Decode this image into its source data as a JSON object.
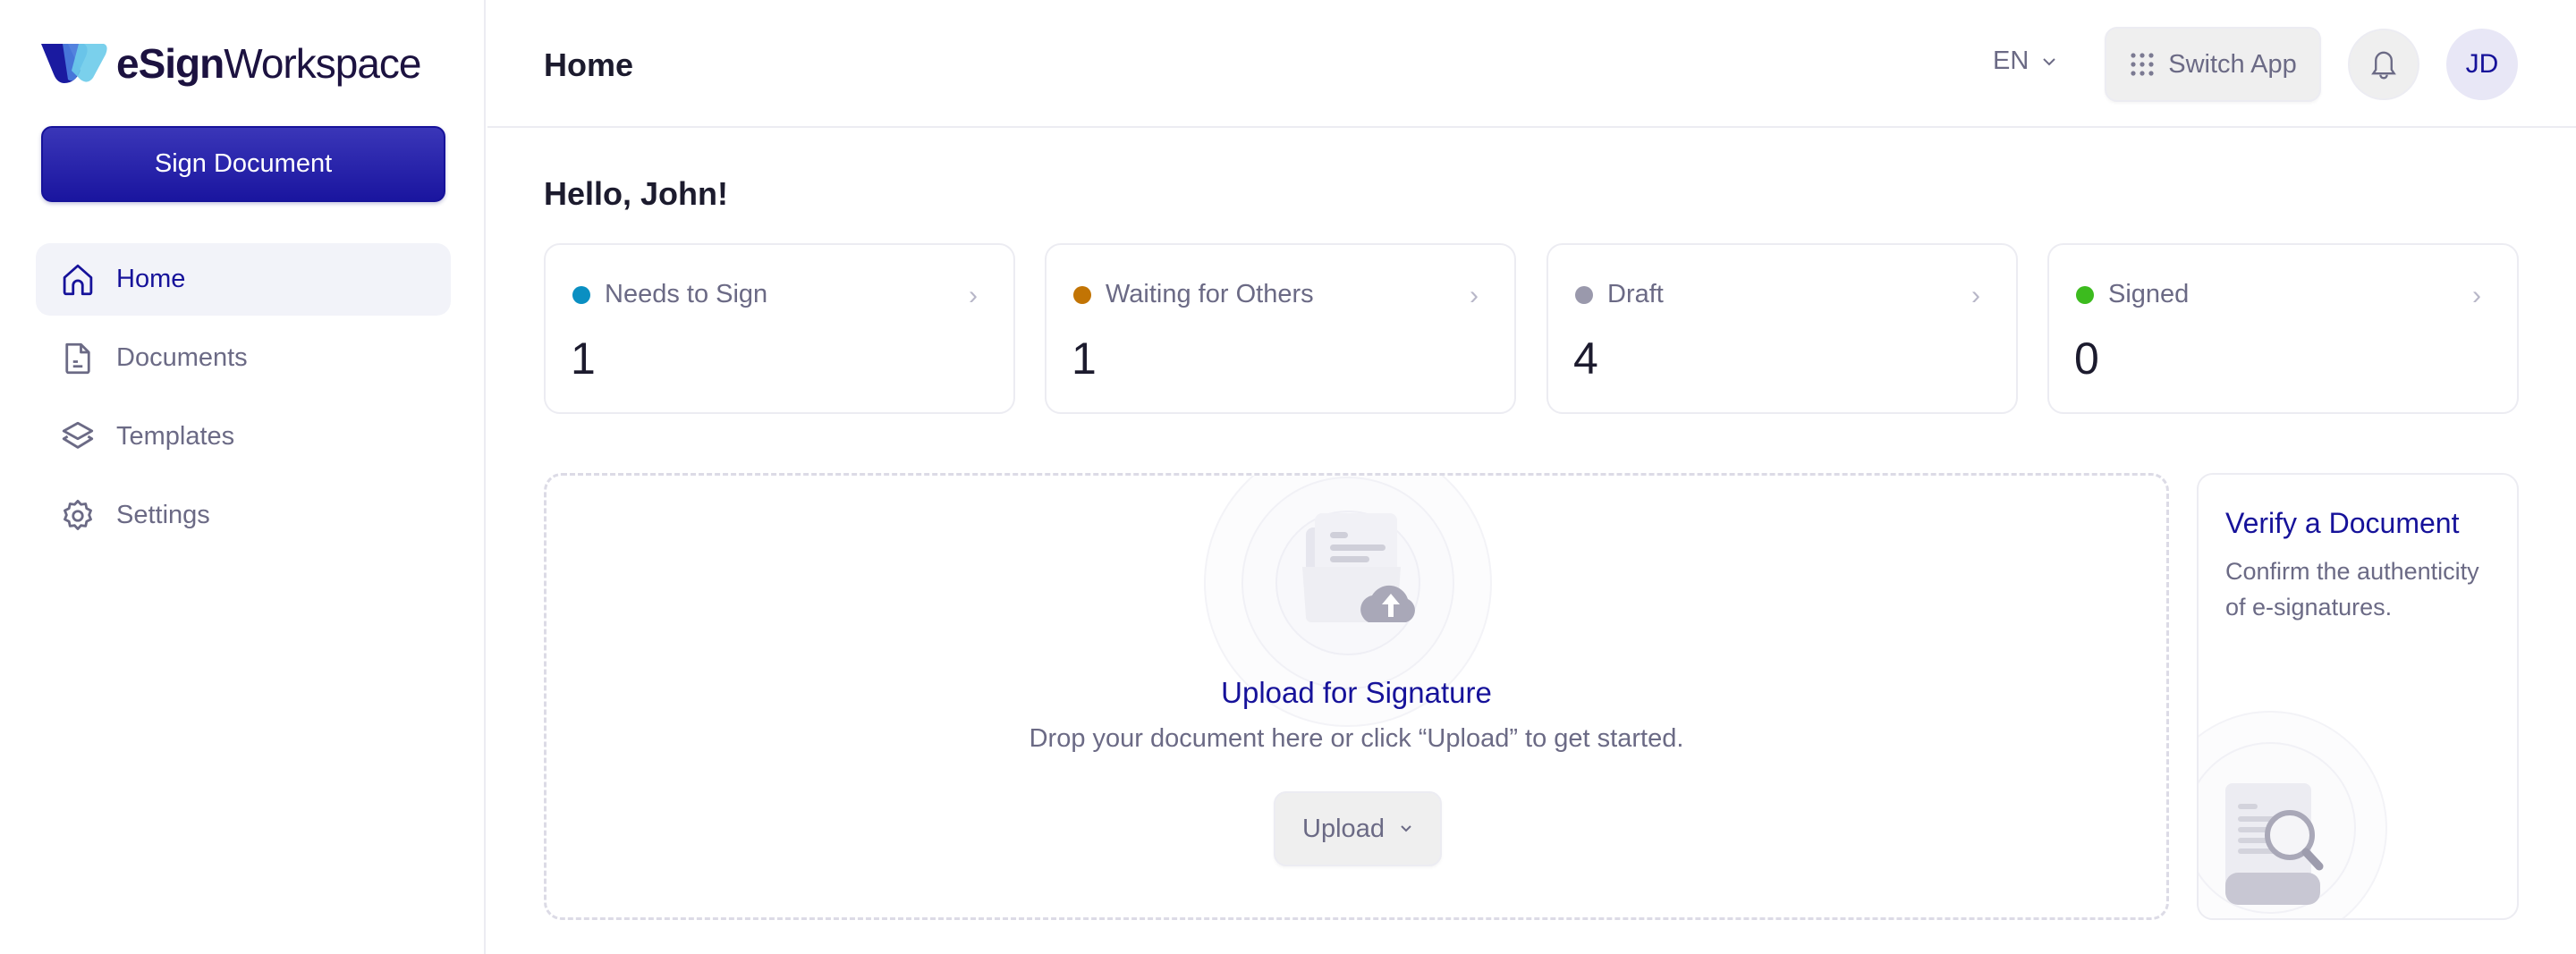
{
  "app": {
    "brand_bold": "eSign",
    "brand_light": "Workspace",
    "brand_colors": {
      "dark": "#1a1aa0",
      "mid": "#4a7bdc",
      "light": "#6ccbea"
    }
  },
  "sidebar": {
    "sign_document_label": "Sign Document",
    "items": [
      {
        "label": "Home",
        "icon": "home-icon",
        "active": true
      },
      {
        "label": "Documents",
        "icon": "document-icon",
        "active": false
      },
      {
        "label": "Templates",
        "icon": "layers-icon",
        "active": false
      },
      {
        "label": "Settings",
        "icon": "gear-icon",
        "active": false
      }
    ]
  },
  "header": {
    "title": "Home",
    "language": "EN",
    "switch_app_label": "Switch App",
    "avatar_initials": "JD"
  },
  "main": {
    "greeting": "Hello, John!",
    "stats": [
      {
        "label": "Needs to Sign",
        "count": "1",
        "color": "#0a8fc2"
      },
      {
        "label": "Waiting for Others",
        "count": "1",
        "color": "#c27404"
      },
      {
        "label": "Draft",
        "count": "4",
        "color": "#9a99ac"
      },
      {
        "label": "Signed",
        "count": "0",
        "color": "#3cbb1e"
      }
    ],
    "upload": {
      "title": "Upload for Signature",
      "subtitle": "Drop your document here or click “Upload” to get started.",
      "button_label": "Upload"
    },
    "verify": {
      "title": "Verify a Document",
      "subtitle": "Confirm the authenticity of e-signatures."
    }
  },
  "colors": {
    "accent": "#16129a",
    "muted_text": "#6b6a85",
    "border": "#ececf2",
    "active_nav_bg": "#f2f3f9"
  }
}
